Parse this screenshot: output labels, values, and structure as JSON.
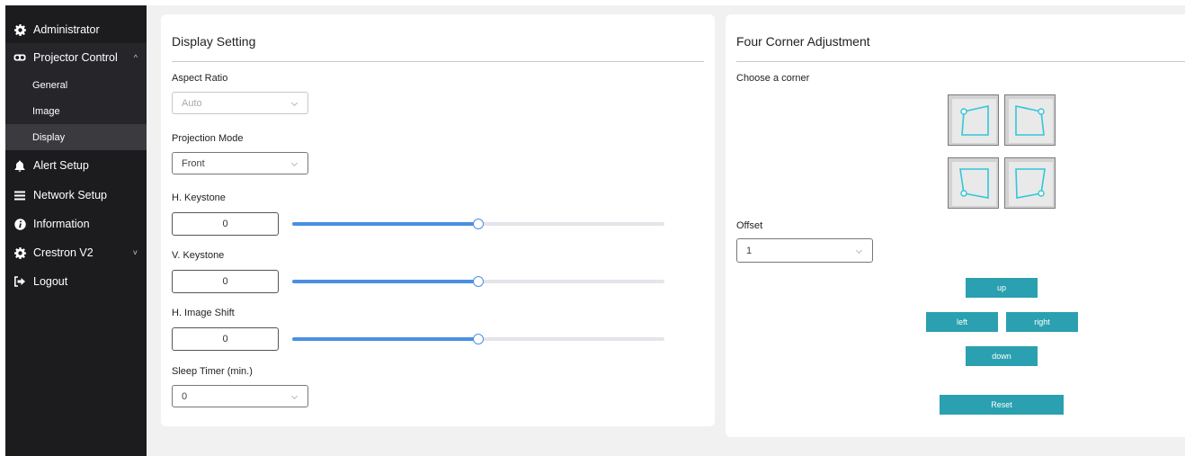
{
  "sidebar": {
    "items": [
      {
        "label": "Administrator",
        "icon": "gear-icon"
      },
      {
        "label": "Projector Control",
        "icon": "projector-icon",
        "chevron": "^"
      },
      {
        "label": "Alert Setup",
        "icon": "bell-icon"
      },
      {
        "label": "Network Setup",
        "icon": "list-icon"
      },
      {
        "label": "Information",
        "icon": "info-icon"
      },
      {
        "label": "Crestron V2",
        "icon": "gear-icon",
        "chevron": "˅"
      },
      {
        "label": "Logout",
        "icon": "logout-icon"
      }
    ],
    "subitems": [
      {
        "label": "General"
      },
      {
        "label": "Image"
      },
      {
        "label": "Display",
        "active": true
      }
    ]
  },
  "display_setting": {
    "title": "Display Setting",
    "aspect_ratio": {
      "label": "Aspect Ratio",
      "value": "Auto",
      "disabled": true
    },
    "projection_mode": {
      "label": "Projection Mode",
      "value": "Front"
    },
    "h_keystone": {
      "label": "H. Keystone",
      "value": "0",
      "slider_fraction": 0.5
    },
    "v_keystone": {
      "label": "V. Keystone",
      "value": "0",
      "slider_fraction": 0.5
    },
    "h_image_shift": {
      "label": "H. Image Shift",
      "value": "0",
      "slider_fraction": 0.5
    },
    "sleep_timer": {
      "label": "Sleep Timer (min.)",
      "value": "0"
    }
  },
  "four_corner": {
    "title": "Four Corner Adjustment",
    "choose_label": "Choose a corner",
    "corners": [
      "top-left",
      "top-right",
      "bottom-left",
      "bottom-right"
    ],
    "offset": {
      "label": "Offset",
      "value": "1"
    },
    "buttons": {
      "up": "up",
      "left": "left",
      "right": "right",
      "down": "down",
      "reset": "Reset"
    }
  },
  "colors": {
    "sidebar_bg": "#1c1c1f",
    "accent_button": "#2aa0b0",
    "slider_fill": "#4a90e2",
    "corner_outline": "#33c6d8"
  }
}
